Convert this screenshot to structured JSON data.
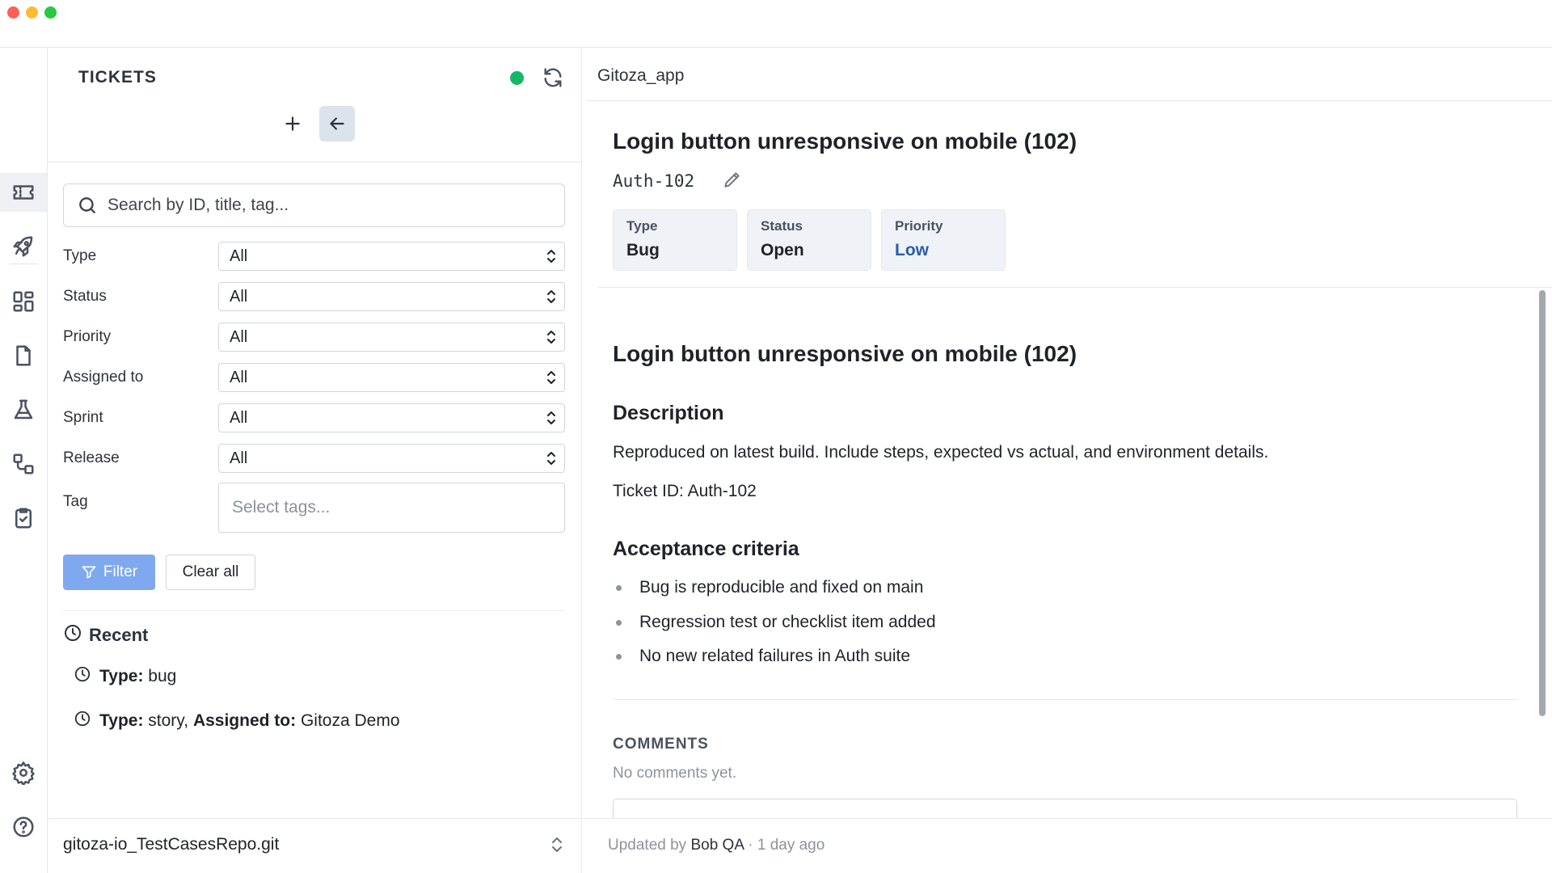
{
  "rail": {
    "items": [
      {
        "name": "tickets",
        "icon": "ticket-icon",
        "active": true
      },
      {
        "name": "releases",
        "icon": "rocket-icon"
      },
      {
        "name": "dashboards",
        "icon": "grid-icon"
      },
      {
        "name": "documents",
        "icon": "file-icon"
      },
      {
        "name": "tests",
        "icon": "flask-icon"
      },
      {
        "name": "workflows",
        "icon": "workflow-icon"
      },
      {
        "name": "checklists",
        "icon": "clipboard-check-icon"
      },
      {
        "name": "settings",
        "icon": "gear-icon"
      },
      {
        "name": "help",
        "icon": "help-icon"
      }
    ]
  },
  "left": {
    "title": "TICKETS",
    "status_color": "#12b76a",
    "search_placeholder": "Search by ID, title, tag...",
    "filters": [
      {
        "label": "Type",
        "value": "All"
      },
      {
        "label": "Status",
        "value": "All"
      },
      {
        "label": "Priority",
        "value": "All"
      },
      {
        "label": "Assigned to",
        "value": "All"
      },
      {
        "label": "Sprint",
        "value": "All"
      },
      {
        "label": "Release",
        "value": "All"
      }
    ],
    "tag_label": "Tag",
    "tag_placeholder": "Select tags...",
    "filter_button": "Filter",
    "clear_button": "Clear all",
    "recent_title": "Recent",
    "recent": [
      {
        "parts": [
          {
            "k": "Type:",
            "v": "bug"
          }
        ]
      },
      {
        "parts": [
          {
            "k": "Type:",
            "v": "story,"
          },
          {
            "k": "Assigned to:",
            "v": "Gitoza Demo"
          }
        ]
      }
    ],
    "repo": "gitoza-io_TestCasesRepo.git"
  },
  "right": {
    "project": "Gitoza_app",
    "ticket_title": "Login button unresponsive on mobile (102)",
    "ticket_key": "Auth-102",
    "cards": [
      {
        "label": "Type",
        "value": "Bug"
      },
      {
        "label": "Status",
        "value": "Open"
      },
      {
        "label": "Priority",
        "value": "Low"
      }
    ],
    "body": {
      "heading": "Login button unresponsive on mobile (102)",
      "description_title": "Description",
      "description": "Reproduced on latest build. Include steps, expected vs actual, and environment details.",
      "ticket_id_line": "Ticket ID: Auth-102",
      "acceptance_title": "Acceptance criteria",
      "acceptance": [
        "Bug is reproducible and fixed on main",
        "Regression test or checklist item added",
        "No new related failures in Auth suite"
      ]
    },
    "comments_title": "COMMENTS",
    "comments_empty": "No comments yet.",
    "footer": {
      "prefix": "Updated by",
      "user": "Bob QA",
      "suffix": "· 1 day ago"
    }
  }
}
